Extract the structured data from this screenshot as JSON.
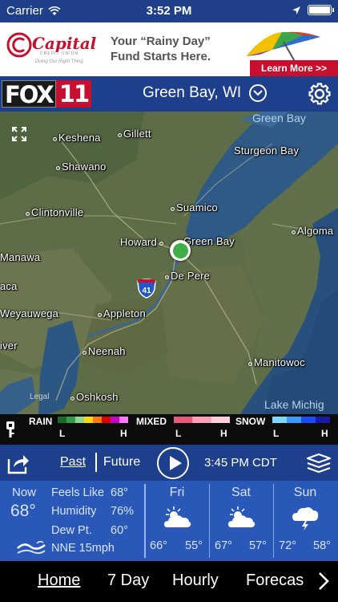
{
  "status_bar": {
    "carrier": "Carrier",
    "time": "3:52 PM"
  },
  "ad": {
    "brand": "Capital",
    "brand_sub": "CREDIT UNION",
    "brand_tagline": "Doing Our Right Thing",
    "headline": "Your “Rainy Day” Fund Starts Here.",
    "cta": "Learn More >>"
  },
  "header": {
    "logo_fox": "FOX",
    "logo_num": "11",
    "location": "Green Bay, WI"
  },
  "map": {
    "cities": [
      "Keshena",
      "Gillett",
      "Shawano",
      "Clintonville",
      "Suamico",
      "Sturgeon Bay",
      "Algoma",
      "Howard",
      "Green Bay",
      "Manawa",
      "De Pere",
      "aca",
      "Weyauwega",
      "Appleton",
      "iver",
      "Neenah",
      "Manitowoc",
      "Oshkosh"
    ],
    "water_labels": [
      "Green Bay",
      "Lake Michig"
    ],
    "legal": "Legal",
    "highway": "41"
  },
  "legend": {
    "rain": "RAIN",
    "mixed": "MIXED",
    "snow": "SNOW",
    "low": "L",
    "high": "H",
    "rain_colors": [
      "#1a6b2a",
      "#2da04a",
      "#8fd88f",
      "#ffd800",
      "#ff7b00",
      "#e00000",
      "#c800c8",
      "#ff77ff"
    ],
    "mixed_colors": [
      "#e85a7a",
      "#ff9fb4",
      "#ffd0dc"
    ],
    "snow_colors": [
      "#7bd8ff",
      "#3a9cff",
      "#1a4cff",
      "#1a1aa8"
    ]
  },
  "playback": {
    "past": "Past",
    "future": "Future",
    "frame_time": "3:45 PM CDT"
  },
  "current": {
    "label": "Now",
    "temp": "68°",
    "feels_like_label": "Feels Like",
    "feels_like": "68°",
    "humidity_label": "Humidity",
    "humidity": "76%",
    "dew_point_label": "Dew Pt.",
    "dew_point": "60°",
    "wind": "NNE 15mph"
  },
  "forecast": [
    {
      "day": "Fri",
      "icon": "partly-cloudy-icon",
      "hi": "66°",
      "lo": "55°"
    },
    {
      "day": "Sat",
      "icon": "partly-cloudy-icon",
      "hi": "67°",
      "lo": "57°"
    },
    {
      "day": "Sun",
      "icon": "thunderstorm-icon",
      "hi": "72°",
      "lo": "58°"
    }
  ],
  "tabs": [
    {
      "label": "Home",
      "active": true
    },
    {
      "label": "7 Day",
      "active": false
    },
    {
      "label": "Hourly",
      "active": false
    },
    {
      "label": "Forecas",
      "active": false
    }
  ]
}
